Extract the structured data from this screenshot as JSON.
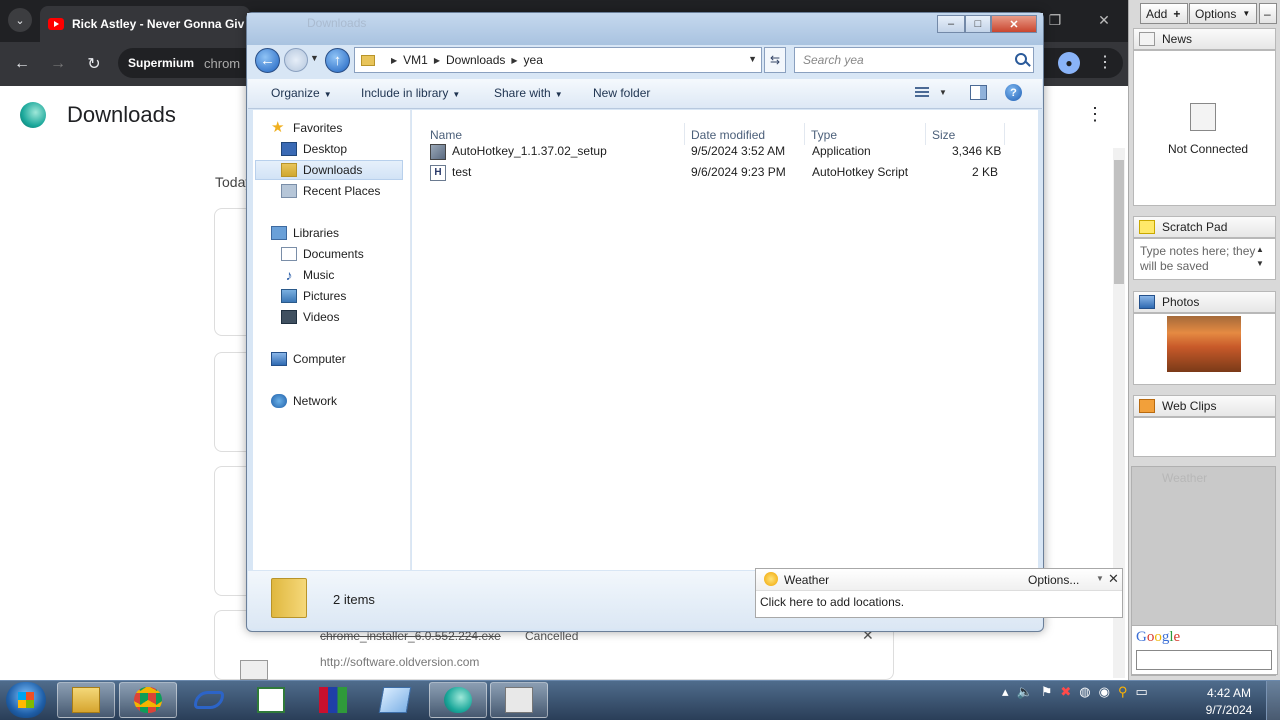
{
  "chrome": {
    "tab_title": "Rick Astley - Never Gonna Giv",
    "omnibox_brand": "Supermium",
    "omnibox_url": "chrom"
  },
  "downloads_page": {
    "title": "Downloads",
    "today_label": "Today",
    "item_filename": "chrome_installer_6.0.552.224.exe",
    "item_status": "Cancelled",
    "item_url": "http://software.oldversion.com"
  },
  "explorer": {
    "title": "Downloads",
    "breadcrumb": [
      "VM1",
      "Downloads",
      "yea"
    ],
    "search_placeholder": "Search yea",
    "toolbar": {
      "organize": "Organize",
      "include_in_library": "Include in library",
      "share_with": "Share with",
      "new_folder": "New folder"
    },
    "nav": {
      "favorites": "Favorites",
      "desktop": "Desktop",
      "downloads": "Downloads",
      "recent_places": "Recent Places",
      "libraries": "Libraries",
      "documents": "Documents",
      "music": "Music",
      "pictures": "Pictures",
      "videos": "Videos",
      "computer": "Computer",
      "network": "Network"
    },
    "columns": {
      "name": "Name",
      "date_modified": "Date modified",
      "type": "Type",
      "size": "Size"
    },
    "files": [
      {
        "name": "AutoHotkey_1.1.37.02_setup",
        "date": "9/5/2024 3:52 AM",
        "type": "Application",
        "size": "3,346 KB"
      },
      {
        "name": "test",
        "date": "9/6/2024 9:23 PM",
        "type": "AutoHotkey Script",
        "size": "2 KB"
      }
    ],
    "status_count": "2 items"
  },
  "weather_popup": {
    "title": "Weather",
    "options": "Options...",
    "body": "Click here to add locations."
  },
  "sidebar": {
    "add": "Add",
    "options": "Options",
    "news_title": "News",
    "news_status": "Not Connected",
    "scratch_title": "Scratch Pad",
    "scratch_text": "Type notes here; they will be saved",
    "photos_title": "Photos",
    "webclips_title": "Web Clips",
    "weather_title": "Weather",
    "google_logo": "Google"
  },
  "taskbar": {
    "time": "4:42 AM",
    "date": "9/7/2024"
  },
  "colors": {
    "accent": "#1f63c1",
    "chrome_dark": "#202124"
  }
}
